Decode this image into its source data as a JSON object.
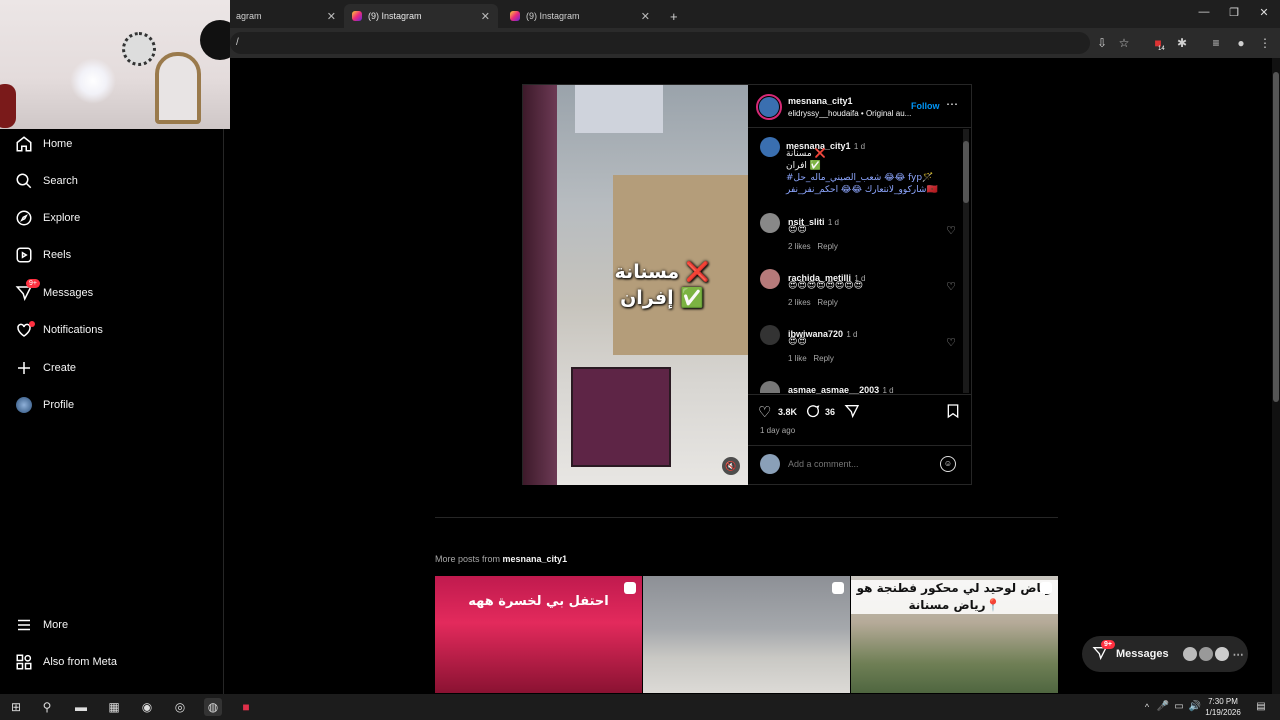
{
  "browser": {
    "tabs": [
      {
        "label": "Instagram",
        "visible_text": "agram"
      },
      {
        "label": "(9) Instagram"
      },
      {
        "label": "(9) Instagram"
      }
    ],
    "new_tab": "+",
    "address": "/",
    "extension_badge": "14"
  },
  "sidebar": {
    "items": [
      {
        "label": "Home",
        "icon": "home-icon"
      },
      {
        "label": "Search",
        "icon": "search-icon"
      },
      {
        "label": "Explore",
        "icon": "compass-icon"
      },
      {
        "label": "Reels",
        "icon": "reels-icon"
      },
      {
        "label": "Messages",
        "icon": "messenger-icon",
        "badge": "9+"
      },
      {
        "label": "Notifications",
        "icon": "heart-icon",
        "dot": true
      },
      {
        "label": "Create",
        "icon": "plus-icon"
      },
      {
        "label": "Profile",
        "icon": "avatar-icon"
      }
    ],
    "more": "More",
    "meta": "Also from Meta"
  },
  "post": {
    "author": "mesnana_city1",
    "follow": "Follow",
    "audio": "elidryssy__houdaifa • Original au...",
    "video_overlay_line1": "مسنانة ❌",
    "video_overlay_line2": "إفران ✅",
    "caption": {
      "user": "mesnana_city1",
      "time": "1 d",
      "line1": "مسنانة ❌",
      "line2": "افران ✅",
      "line3": "#شعب_الصيني_ماله_حل 😂😂 fyp🪄",
      "line4": "شاركوو_لانتعارك 😂😂 احكم_نفر_نفر🇲🇦"
    },
    "comments": [
      {
        "user": "nsit_sliti",
        "time": "1 d",
        "text": "😍😍",
        "likes": "2 likes",
        "reply": "Reply"
      },
      {
        "user": "rachida_metilli",
        "time": "1 d",
        "text": "😍😍😍😍😍😍😍😍",
        "likes": "2 likes",
        "reply": "Reply"
      },
      {
        "user": "ibwiwana720",
        "time": "1 d",
        "text": "😍😍",
        "likes": "1 like",
        "reply": "Reply"
      },
      {
        "user": "asmae_asmae__2003",
        "time": "1 d",
        "text": "",
        "likes": "",
        "reply": ""
      }
    ],
    "like_count": "3.8K",
    "comment_count": "36",
    "posted": "1 day ago",
    "add_comment_placeholder": "Add a comment..."
  },
  "more_posts": {
    "prefix": "More posts from ",
    "user": "mesnana_city1",
    "thumbs": [
      {
        "text": "احتفل بي لخسرة ههه"
      },
      {
        "text": ""
      },
      {
        "text": "رياض لوحيد لي محكور فطنجة هو رياض مسنانة📍"
      }
    ]
  },
  "messages_pill": {
    "label": "Messages",
    "badge": "9+"
  },
  "taskbar": {
    "time": "7:30 PM",
    "date": "1/19/2026"
  }
}
